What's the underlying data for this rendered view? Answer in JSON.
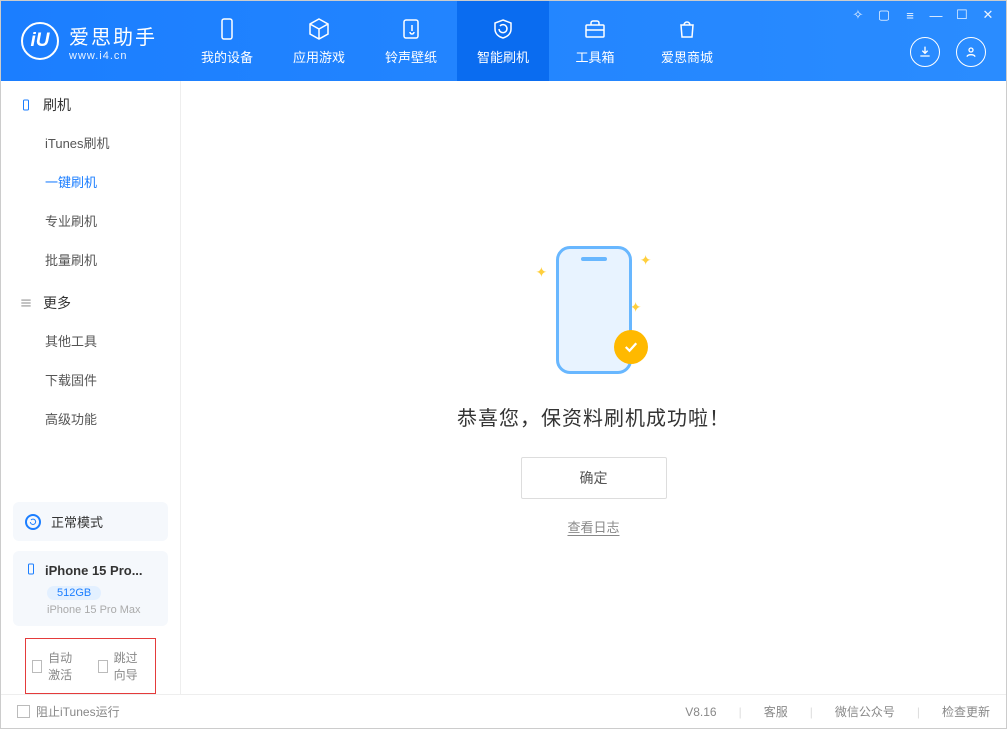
{
  "brand": {
    "cn": "爱思助手",
    "en": "www.i4.cn",
    "logo_letter": "iU"
  },
  "nav": {
    "items": [
      {
        "label": "我的设备",
        "icon": "device"
      },
      {
        "label": "应用游戏",
        "icon": "cube"
      },
      {
        "label": "铃声壁纸",
        "icon": "music"
      },
      {
        "label": "智能刷机",
        "icon": "refresh",
        "active": true
      },
      {
        "label": "工具箱",
        "icon": "toolbox"
      },
      {
        "label": "爱思商城",
        "icon": "bag"
      }
    ]
  },
  "sidebar": {
    "section1": {
      "title": "刷机",
      "items": [
        {
          "label": "iTunes刷机"
        },
        {
          "label": "一键刷机",
          "active": true
        },
        {
          "label": "专业刷机"
        },
        {
          "label": "批量刷机"
        }
      ]
    },
    "section2": {
      "title": "更多",
      "items": [
        {
          "label": "其他工具"
        },
        {
          "label": "下载固件"
        },
        {
          "label": "高级功能"
        }
      ]
    },
    "status_label": "正常模式",
    "device": {
      "name": "iPhone 15 Pro...",
      "storage": "512GB",
      "full": "iPhone 15 Pro Max"
    },
    "checks": {
      "auto_activate": "自动激活",
      "skip_guide": "跳过向导"
    }
  },
  "main": {
    "success_text": "恭喜您，保资料刷机成功啦！",
    "ok_label": "确定",
    "log_link": "查看日志"
  },
  "footer": {
    "block_itunes": "阻止iTunes运行",
    "version": "V8.16",
    "links": {
      "support": "客服",
      "wechat": "微信公众号",
      "update": "检查更新"
    }
  }
}
